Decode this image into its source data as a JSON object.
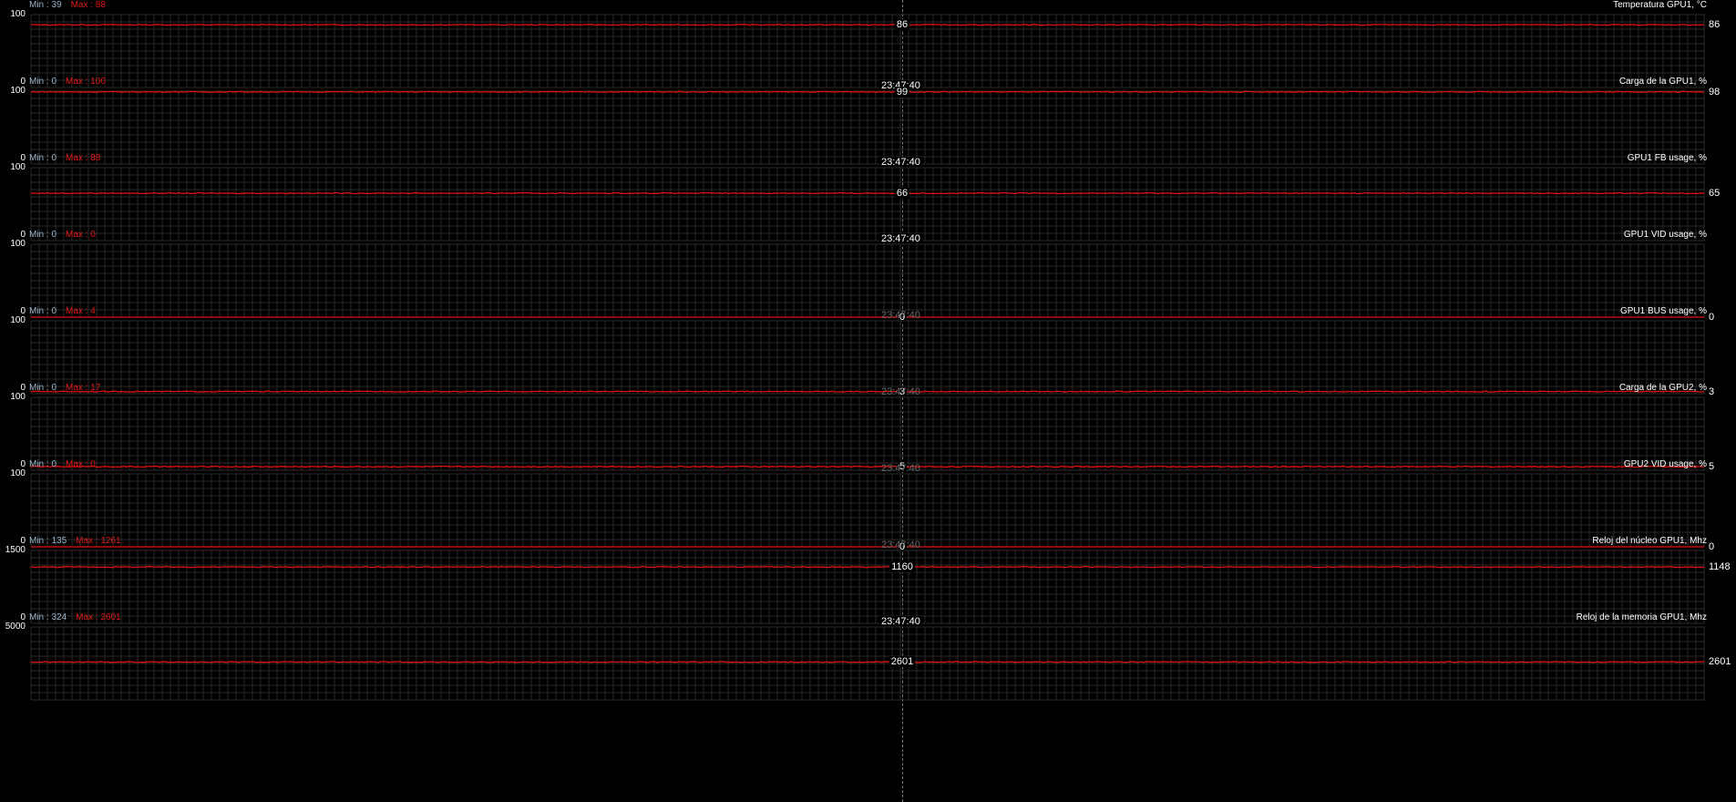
{
  "panels": [
    {
      "title": "Temperatura GPU1, °C",
      "min_label": "Min : 39",
      "max_label": "Max : 88",
      "ymax": "100",
      "ymin": "0",
      "scale_max": 100,
      "current_left": "86",
      "current_right": "86",
      "current": 86,
      "time": "23:47:40",
      "time_dim": false,
      "series": [
        {
          "from": 0,
          "to": 1,
          "value": 86
        }
      ]
    },
    {
      "title": "Carga de la GPU1, %",
      "min_label": "Min : 0",
      "max_label": "Max : 100",
      "ymax": "100",
      "ymin": "0",
      "scale_max": 100,
      "current_left": "99",
      "current_right": "98",
      "current": 99,
      "time": "23:47:40",
      "time_dim": false,
      "series": [
        {
          "from": 0,
          "to": 1,
          "value": 99
        }
      ]
    },
    {
      "title": "GPU1 FB usage, %",
      "min_label": "Min : 0",
      "max_label": "Max : 88",
      "ymax": "100",
      "ymin": "0",
      "scale_max": 100,
      "current_left": "66",
      "current_right": "65",
      "current": 66,
      "time": "23:47:40",
      "time_dim": false,
      "series": [
        {
          "from": 0,
          "to": 1,
          "value": 65
        }
      ]
    },
    {
      "title": "GPU1 VID usage, %",
      "min_label": "Min : 0",
      "max_label": "Max : 0",
      "ymax": "100",
      "ymin": "0",
      "scale_max": 100,
      "current_left": "0",
      "current_right": "0",
      "current": 0,
      "time": "23:47:40",
      "time_dim": true,
      "series": [
        {
          "from": 0,
          "to": 1,
          "value": 0
        }
      ]
    },
    {
      "title": "GPU1 BUS usage, %",
      "min_label": "Min : 0",
      "max_label": "Max : 4",
      "ymax": "100",
      "ymin": "0",
      "scale_max": 100,
      "current_left": "3",
      "current_right": "3",
      "current": 3,
      "time": "23:47:40",
      "time_dim": true,
      "series": [
        {
          "from": 0,
          "to": 1,
          "value": 3
        }
      ]
    },
    {
      "title": "Carga de la GPU2, %",
      "min_label": "Min : 0",
      "max_label": "Max : 17",
      "ymax": "100",
      "ymin": "0",
      "scale_max": 100,
      "current_left": "5",
      "current_right": "5",
      "current": 5,
      "time": "23:47:40",
      "time_dim": true,
      "series": [
        {
          "from": 0,
          "to": 1,
          "value": 5
        }
      ]
    },
    {
      "title": "GPU2 VID usage, %",
      "min_label": "Min : 0",
      "max_label": "Max : 0",
      "ymax": "100",
      "ymin": "0",
      "scale_max": 100,
      "current_left": "0",
      "current_right": "0",
      "current": 0,
      "time": "23:47:40",
      "time_dim": true,
      "series": [
        {
          "from": 0,
          "to": 1,
          "value": 0
        }
      ]
    },
    {
      "title": "Reloj del núcleo GPU1, Mhz",
      "min_label": "Min : 135",
      "max_label": "Max : 1261",
      "ymax": "1500",
      "ymin": "0",
      "scale_max": 1500,
      "current_left": "1160",
      "current_right": "1148",
      "current": 1160,
      "time": "23:47:40",
      "time_dim": false,
      "series": [
        {
          "from": 0,
          "to": 1,
          "value": 1160
        }
      ]
    },
    {
      "title": "Reloj de la memoria GPU1, Mhz",
      "min_label": "Min : 324",
      "max_label": "Max : 2601",
      "ymax": "5000",
      "ymin": "",
      "scale_max": 5000,
      "current_left": "2601",
      "current_right": "2601",
      "current": 2601,
      "time": "",
      "time_dim": false,
      "series": [
        {
          "from": 0,
          "to": 1,
          "value": 2601
        }
      ]
    }
  ],
  "colors": {
    "trace": "#e01010",
    "grid": "#2a2a2a",
    "background": "#000000"
  }
}
